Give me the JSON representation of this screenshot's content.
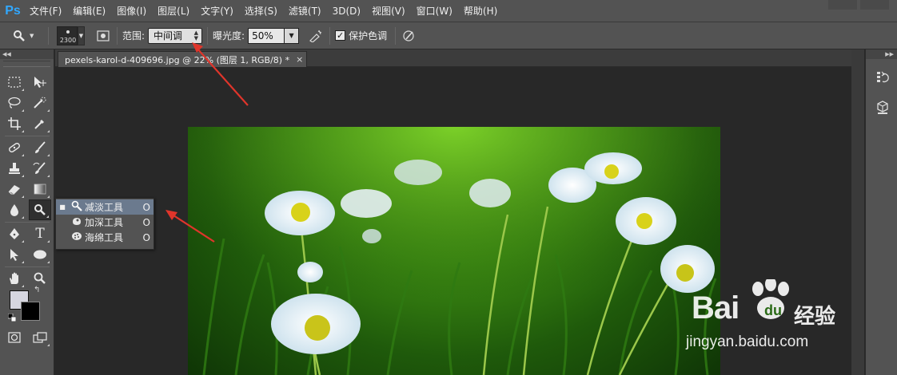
{
  "app": {
    "logo": "Ps"
  },
  "menu": [
    "文件(F)",
    "编辑(E)",
    "图像(I)",
    "图层(L)",
    "文字(Y)",
    "选择(S)",
    "滤镜(T)",
    "3D(D)",
    "视图(V)",
    "窗口(W)",
    "帮助(H)"
  ],
  "options": {
    "brush_size": "2300",
    "range_label": "范围:",
    "range_value": "中间调",
    "exposure_label": "曝光度:",
    "exposure_value": "50%",
    "protect_label": "保护色调",
    "protect_checked": "✓"
  },
  "document": {
    "tab_title": "pexels-karol-d-409696.jpg @ 22% (图层 1, RGB/8) *",
    "close": "×"
  },
  "flyout": [
    {
      "label": "减淡工具",
      "shortcut": "O",
      "icon": "dodge-icon",
      "glyph": "🔍",
      "bullet": "■"
    },
    {
      "label": "加深工具",
      "shortcut": "O",
      "icon": "burn-icon",
      "glyph": "✋",
      "bullet": ""
    },
    {
      "label": "海绵工具",
      "shortcut": "O",
      "icon": "sponge-icon",
      "glyph": "◍",
      "bullet": ""
    }
  ],
  "colors": {
    "menubar_bg": "#535353",
    "workspace_bg": "#282828",
    "accent_logo": "#31a8ff",
    "annotation_arrow": "#e0352b",
    "foreground": "#d6d6e0",
    "background": "#000000"
  },
  "watermark": {
    "logo": "Bai du",
    "cn": "经验",
    "url": "jingyan.baidu.com"
  }
}
